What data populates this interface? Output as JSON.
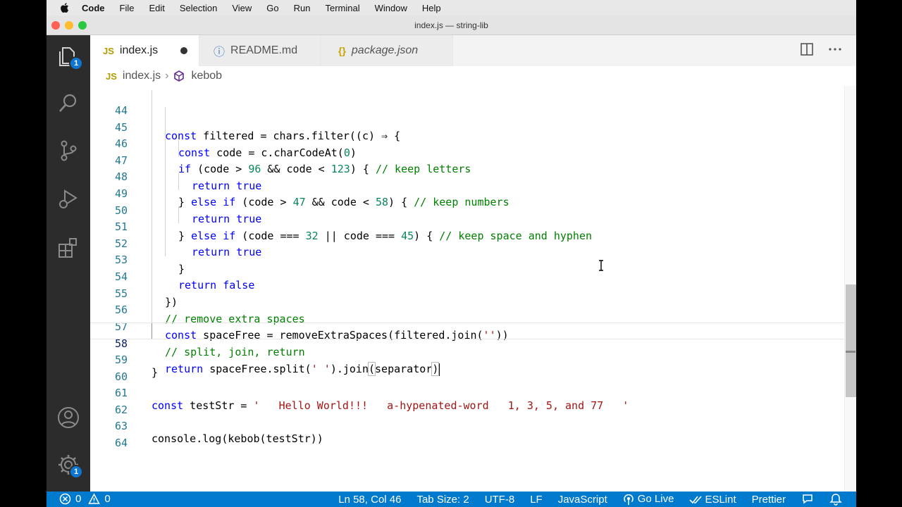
{
  "menubar": {
    "app_name": "Code",
    "items": [
      "File",
      "Edit",
      "Selection",
      "View",
      "Go",
      "Run",
      "Terminal",
      "Window",
      "Help"
    ]
  },
  "window": {
    "title": "index.js — string-lib",
    "traffic_colors": [
      "#fe5f57",
      "#febc2e",
      "#28c840"
    ]
  },
  "activity_bar": {
    "items": [
      {
        "icon": "files-icon",
        "badge": "1"
      },
      {
        "icon": "search-icon"
      },
      {
        "icon": "source-control-icon"
      },
      {
        "icon": "run-debug-icon"
      },
      {
        "icon": "extensions-icon"
      }
    ],
    "bottom": [
      {
        "icon": "account-icon"
      },
      {
        "icon": "settings-gear-icon",
        "badge": "1"
      }
    ]
  },
  "tabs": [
    {
      "icon_text": "JS",
      "label": "index.js",
      "active": true,
      "dirty": true
    },
    {
      "icon_text": "ⓘ",
      "label": "README.md",
      "active": false
    },
    {
      "icon_text": "{}",
      "label": "package.json",
      "active": false,
      "italic": true
    }
  ],
  "breadcrumb": {
    "file": "index.js",
    "symbol": "kebob"
  },
  "editor": {
    "current_line": 58,
    "lines": [
      {
        "n": "44",
        "indent": 1
      },
      {
        "n": "45",
        "indent": 2
      },
      {
        "n": "46",
        "indent": 2
      },
      {
        "n": "47",
        "indent": 3
      },
      {
        "n": "48",
        "indent": 2
      },
      {
        "n": "49",
        "indent": 3
      },
      {
        "n": "50",
        "indent": 2
      },
      {
        "n": "51",
        "indent": 3
      },
      {
        "n": "52",
        "indent": 2
      },
      {
        "n": "53",
        "indent": 2
      },
      {
        "n": "54",
        "indent": 1
      },
      {
        "n": "55",
        "indent": 1
      },
      {
        "n": "56",
        "indent": 1
      },
      {
        "n": "57",
        "indent": 1
      },
      {
        "n": "58",
        "indent": 1
      },
      {
        "n": "59",
        "indent": 0
      },
      {
        "n": "60",
        "indent": 0
      },
      {
        "n": "61",
        "indent": 0
      },
      {
        "n": "62",
        "indent": 0
      },
      {
        "n": "63",
        "indent": 0
      },
      {
        "n": "64",
        "indent": 0
      }
    ],
    "code": {
      "l44": [
        "const",
        " filtered = chars.filter((c) ⇒ {"
      ],
      "l45": [
        "const",
        " code = c.charCodeAt(",
        "0",
        ")"
      ],
      "l46": [
        "if",
        " (code > ",
        "96",
        " && code < ",
        "123",
        ") { ",
        "// keep letters"
      ],
      "l47": [
        "return",
        " ",
        "true"
      ],
      "l48": [
        "} ",
        "else",
        " ",
        "if",
        " (code > ",
        "47",
        " && code < ",
        "58",
        ") { ",
        "// keep numbers"
      ],
      "l49": [
        "return",
        " ",
        "true"
      ],
      "l50": [
        "} ",
        "else",
        " ",
        "if",
        " (code ",
        "===",
        " ",
        "32",
        " || code ",
        "===",
        " ",
        "45",
        ") { ",
        "// keep space and hyphen"
      ],
      "l51": [
        "return",
        " ",
        "true"
      ],
      "l52": [
        "}"
      ],
      "l53": [
        "return",
        " ",
        "false"
      ],
      "l54": [
        "})"
      ],
      "l55": [
        "// remove extra spaces"
      ],
      "l56": [
        "const",
        " spaceFree = removeExtraSpaces(filtered.join(",
        "''",
        "))"
      ],
      "l57": [
        "// split, join, return"
      ],
      "l58": [
        "return",
        " spaceFree.split(",
        "' '",
        ").join",
        "(",
        "separator",
        ")"
      ],
      "l59": [
        "}"
      ],
      "l61": [
        "const",
        " testStr = ",
        "'   Hello World!!!   a-hypenated-word   1, 3, 5, and 77   '"
      ],
      "l63": [
        "console.log(kebob(testStr))"
      ]
    }
  },
  "status": {
    "errors": "0",
    "warnings": "0",
    "position": "Ln 58, Col 46",
    "tab_size": "Tab Size: 2",
    "encoding": "UTF-8",
    "eol": "LF",
    "language": "JavaScript",
    "go_live": "Go Live",
    "eslint": "ESLint",
    "prettier": "Prettier"
  },
  "colors": {
    "accent": "#007acc",
    "activity_bg": "#2c2c2c",
    "keyword": "#0000ff",
    "number": "#098658",
    "comment": "#008000",
    "string": "#a31515",
    "line_number": "#237893"
  }
}
